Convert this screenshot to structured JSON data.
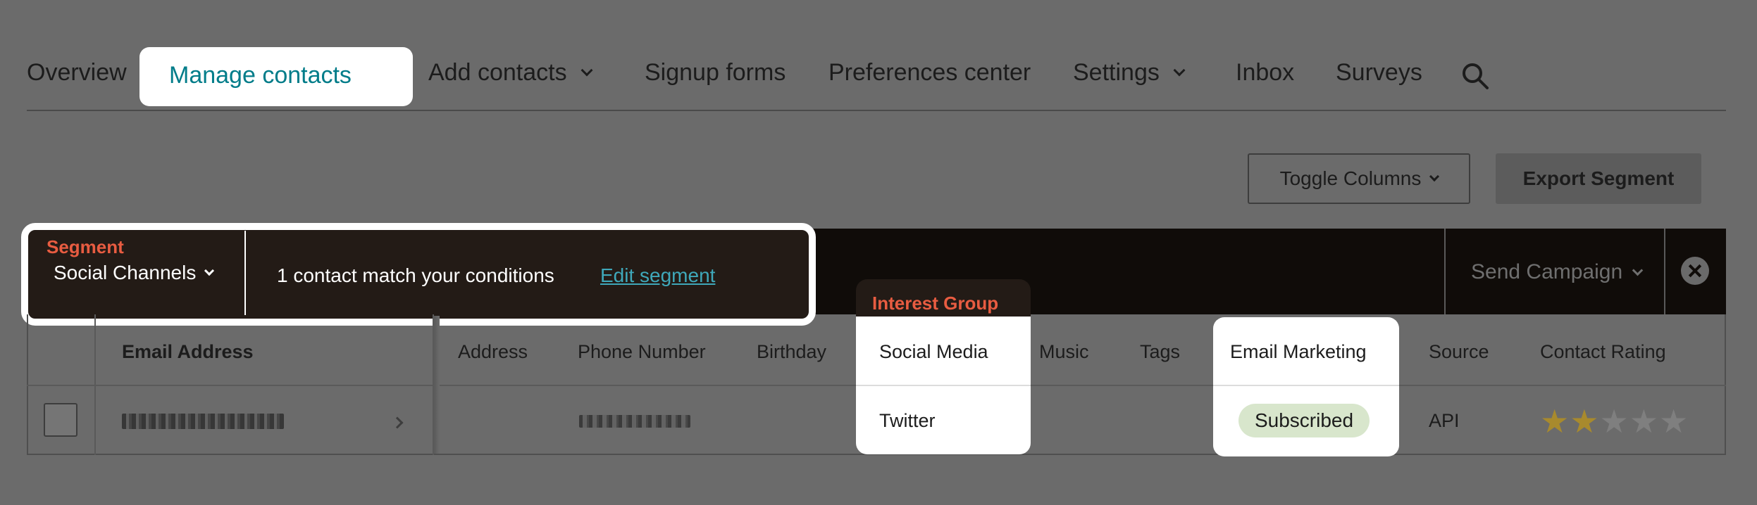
{
  "nav": {
    "items": [
      {
        "label": "Overview"
      },
      {
        "label": "Manage contacts"
      },
      {
        "label": "Add contacts"
      },
      {
        "label": "Signup forms"
      },
      {
        "label": "Preferences center"
      },
      {
        "label": "Settings"
      },
      {
        "label": "Inbox"
      },
      {
        "label": "Surveys"
      }
    ],
    "search_icon": "search-icon"
  },
  "toolbar": {
    "toggle_columns": "Toggle Columns",
    "export_segment": "Export Segment"
  },
  "segment": {
    "label": "Segment",
    "selected": "Social Channels",
    "match_text": "1 contact match your conditions",
    "edit_link": "Edit segment",
    "send_campaign": "Send Campaign"
  },
  "table": {
    "headers": [
      "Email Address",
      "Address",
      "Phone Number",
      "Birthday",
      "Social Media",
      "Music",
      "Tags",
      "Email Marketing",
      "Source",
      "Contact Rating"
    ],
    "interest_group_label": "Interest Group",
    "row": {
      "social_media": "Twitter",
      "email_marketing": "Subscribed",
      "source": "API",
      "rating": 2,
      "rating_max": 5
    }
  },
  "colors": {
    "accent": "#007c89",
    "segment_label": "#e85c41",
    "link": "#3fa8ba",
    "badge_bg": "#d8e6cc",
    "star": "#a88a2d"
  }
}
